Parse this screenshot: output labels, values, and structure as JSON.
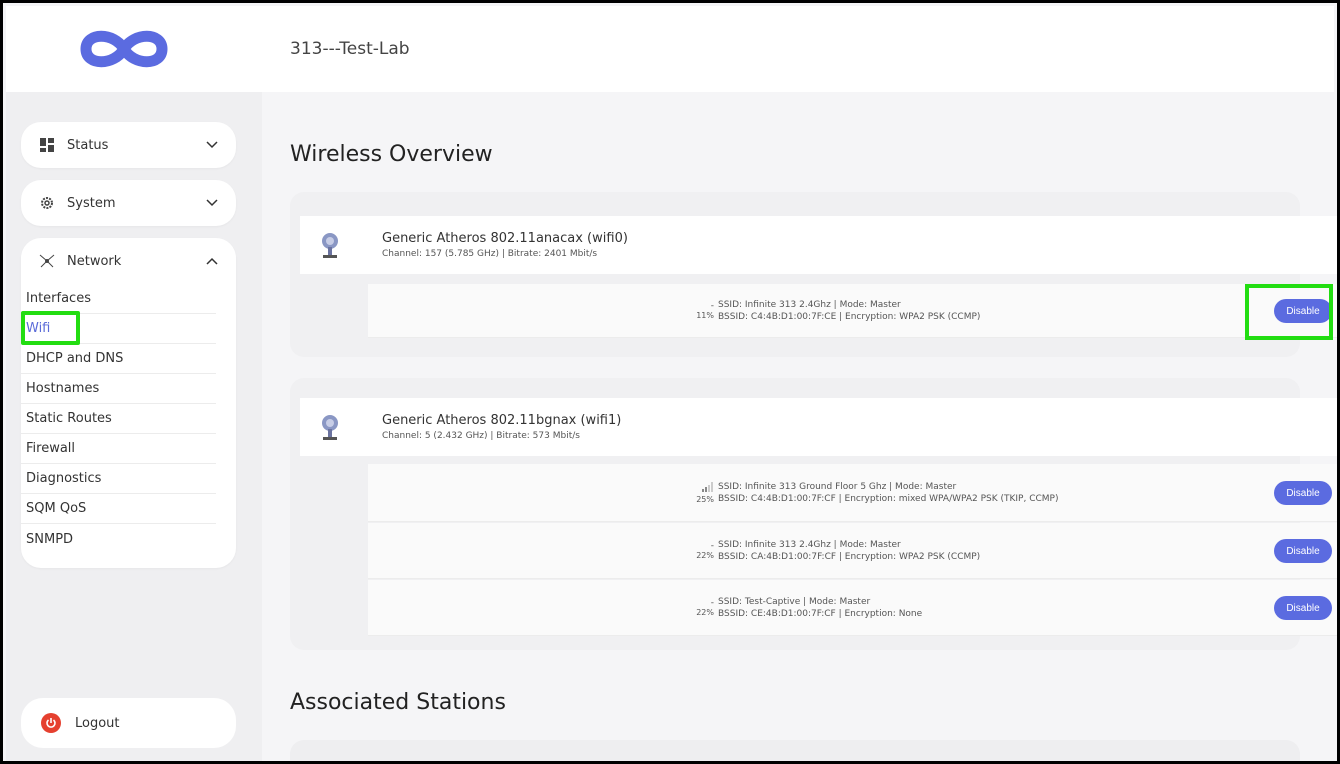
{
  "header": {
    "title": "313---Test-Lab"
  },
  "sidebar": {
    "groups": [
      {
        "label": "Status",
        "icon": "dashboard-icon"
      },
      {
        "label": "System",
        "icon": "gear-icon"
      },
      {
        "label": "Network",
        "icon": "network-icon"
      }
    ],
    "network_items": [
      "Interfaces",
      "Wifi",
      "DHCP and DNS",
      "Hostnames",
      "Static Routes",
      "Firewall",
      "Diagnostics",
      "SQM QoS",
      "SNMPD"
    ],
    "logout_label": "Logout"
  },
  "main": {
    "title": "Wireless Overview",
    "radios": [
      {
        "name": "Generic Atheros 802.11anacax (wifi0)",
        "info": "Channel: 157 (5.785 GHz) | Bitrate: 2401 Mbit/s",
        "networks": [
          {
            "signal": "11%",
            "line1": "SSID: Infinite 313 2.4Ghz | Mode: Master",
            "line2": "BSSID: C4:4B:D1:00:7F:CE | Encryption: WPA2 PSK (CCMP)",
            "button": "Disable"
          }
        ]
      },
      {
        "name": "Generic Atheros 802.11bgnax (wifi1)",
        "info": "Channel: 5 (2.432 GHz) | Bitrate: 573 Mbit/s",
        "networks": [
          {
            "signal": "25%",
            "line1": "SSID: Infinite 313 Ground Floor 5 Ghz | Mode: Master",
            "line2": "BSSID: C4:4B:D1:00:7F:CF | Encryption: mixed WPA/WPA2 PSK (TKIP, CCMP)",
            "button": "Disable"
          },
          {
            "signal": "22%",
            "line1": "SSID: Infinite 313 2.4Ghz | Mode: Master",
            "line2": "BSSID: CA:4B:D1:00:7F:CF | Encryption: WPA2 PSK (CCMP)",
            "button": "Disable"
          },
          {
            "signal": "22%",
            "line1": "SSID: Test-Captive | Mode: Master",
            "line2": "BSSID: CE:4B:D1:00:7F:CF | Encryption: None",
            "button": "Disable"
          }
        ]
      }
    ],
    "stations_title": "Associated Stations"
  },
  "colors": {
    "accent": "#5b6be0",
    "highlight": "#22dd11",
    "logout": "#e5402f"
  }
}
